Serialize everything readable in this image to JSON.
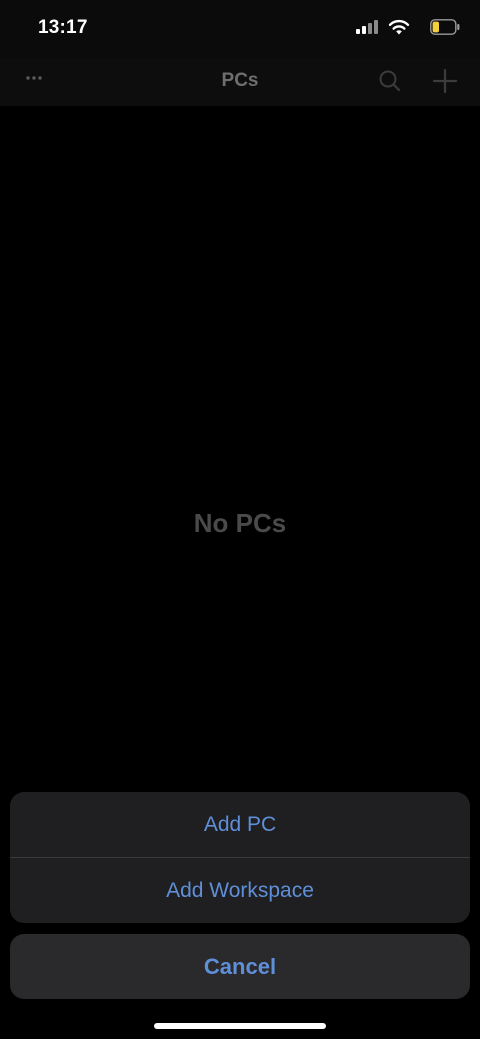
{
  "status_bar": {
    "time": "13:17",
    "icons": [
      "signal-icon",
      "wifi-icon",
      "battery-icon"
    ],
    "battery_color": "#f2d13a",
    "battery_level": 0.3
  },
  "nav": {
    "title": "PCs",
    "left_icon": "more-icon",
    "right_icons": [
      "search-icon",
      "add-icon"
    ]
  },
  "main": {
    "empty_text": "No PCs"
  },
  "action_sheet": {
    "actions": [
      {
        "label": "Add PC"
      },
      {
        "label": "Add Workspace"
      }
    ],
    "cancel_label": "Cancel",
    "accent_color": "#5f8fd8"
  }
}
